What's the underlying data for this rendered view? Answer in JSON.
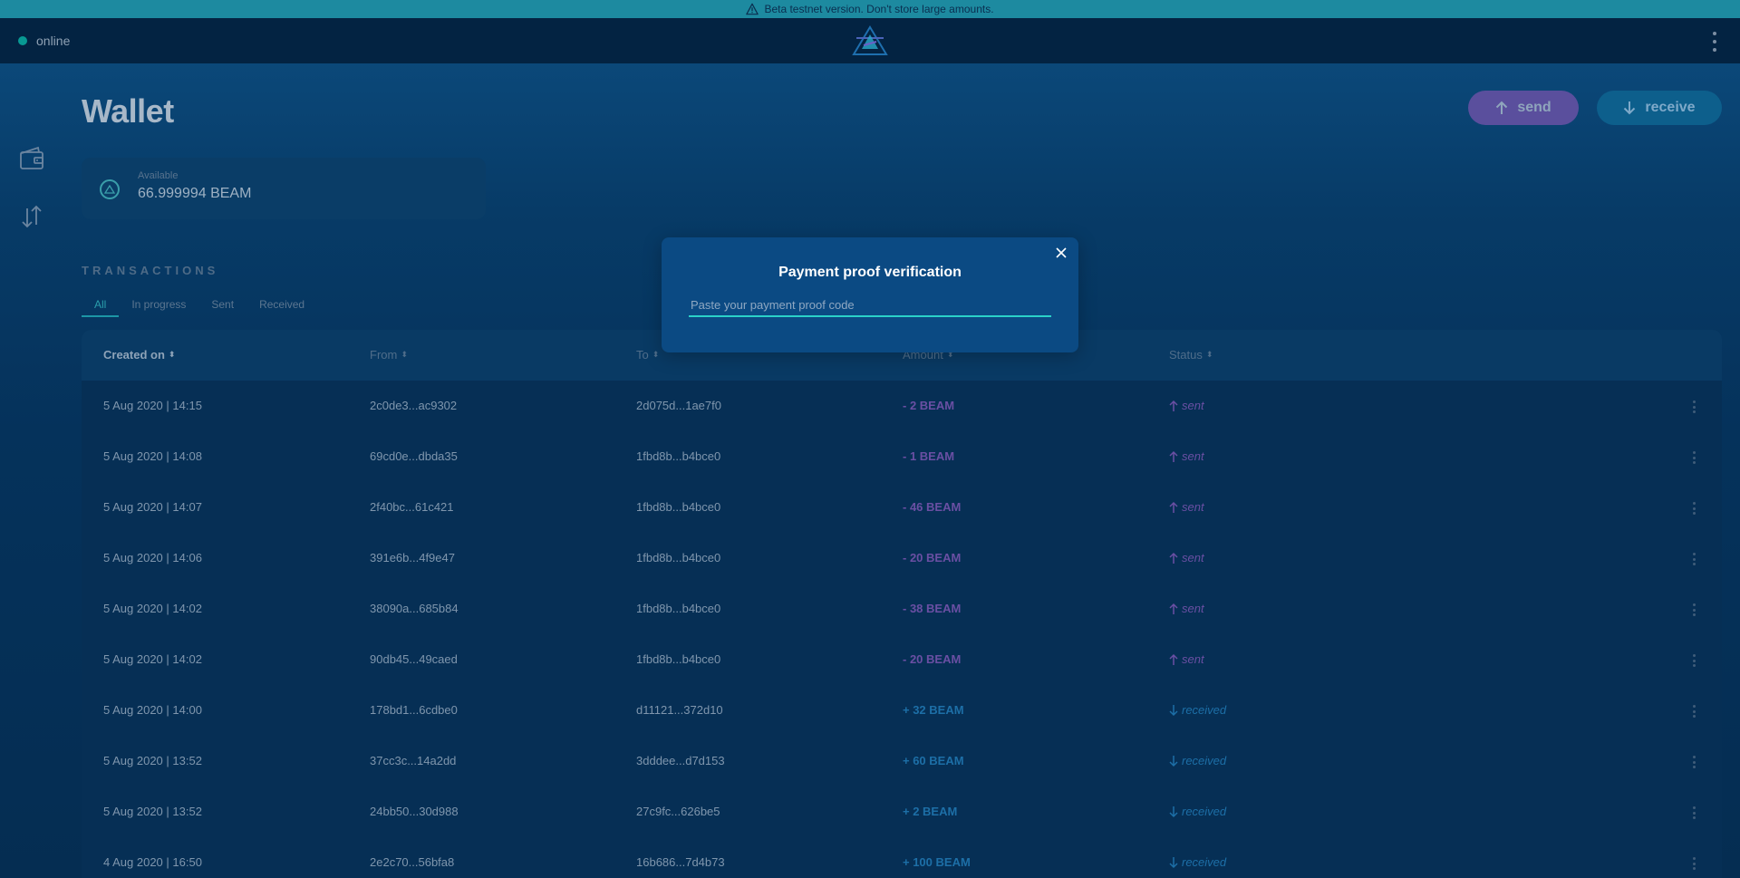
{
  "banner": {
    "text": "Beta testnet version. Don't store large amounts.",
    "icon": "warning-icon"
  },
  "header": {
    "status_label": "online",
    "status_color": "#0bccb6",
    "logo": "beam-logo",
    "menu_icon": "more-vertical-icon"
  },
  "sidebar": {
    "items": [
      {
        "icon": "wallet-icon"
      },
      {
        "icon": "transfer-arrows-icon"
      }
    ]
  },
  "page": {
    "title": "Wallet",
    "send_label": "send",
    "receive_label": "receive",
    "send_color": "#5a4f9d",
    "receive_color": "#0d5f8c"
  },
  "balance": {
    "label": "Available",
    "value": "66.999994 BEAM",
    "icon": "beam-coin-icon"
  },
  "transactions": {
    "title": "TRANSACTIONS",
    "tabs": [
      {
        "label": "All",
        "active": true
      },
      {
        "label": "In progress",
        "active": false
      },
      {
        "label": "Sent",
        "active": false
      },
      {
        "label": "Received",
        "active": false
      }
    ],
    "columns": [
      "Created on",
      "From",
      "To",
      "Amount",
      "Status"
    ],
    "rows": [
      {
        "created": "5 Aug 2020 | 14:15",
        "from": "2c0de3...ac9302",
        "to": "2d075d...1ae7f0",
        "amount": "- 2 BEAM",
        "status": "sent"
      },
      {
        "created": "5 Aug 2020 | 14:08",
        "from": "69cd0e...dbda35",
        "to": "1fbd8b...b4bce0",
        "amount": "- 1 BEAM",
        "status": "sent"
      },
      {
        "created": "5 Aug 2020 | 14:07",
        "from": "2f40bc...61c421",
        "to": "1fbd8b...b4bce0",
        "amount": "- 46 BEAM",
        "status": "sent"
      },
      {
        "created": "5 Aug 2020 | 14:06",
        "from": "391e6b...4f9e47",
        "to": "1fbd8b...b4bce0",
        "amount": "- 20 BEAM",
        "status": "sent"
      },
      {
        "created": "5 Aug 2020 | 14:02",
        "from": "38090a...685b84",
        "to": "1fbd8b...b4bce0",
        "amount": "- 38 BEAM",
        "status": "sent"
      },
      {
        "created": "5 Aug 2020 | 14:02",
        "from": "90db45...49caed",
        "to": "1fbd8b...b4bce0",
        "amount": "- 20 BEAM",
        "status": "sent"
      },
      {
        "created": "5 Aug 2020 | 14:00",
        "from": "178bd1...6cdbe0",
        "to": "d11121...372d10",
        "amount": "+ 32 BEAM",
        "status": "received"
      },
      {
        "created": "5 Aug 2020 | 13:52",
        "from": "37cc3c...14a2dd",
        "to": "3dddee...d7d153",
        "amount": "+ 60 BEAM",
        "status": "received"
      },
      {
        "created": "5 Aug 2020 | 13:52",
        "from": "24bb50...30d988",
        "to": "27c9fc...626be5",
        "amount": "+ 2 BEAM",
        "status": "received"
      },
      {
        "created": "4 Aug 2020 | 16:50",
        "from": "2e2c70...56bfa8",
        "to": "16b686...7d4b73",
        "amount": "+ 100 BEAM",
        "status": "received"
      }
    ]
  },
  "modal": {
    "title": "Payment proof verification",
    "input_placeholder": "Paste your payment proof code",
    "input_value": "",
    "close_icon": "close-icon"
  }
}
